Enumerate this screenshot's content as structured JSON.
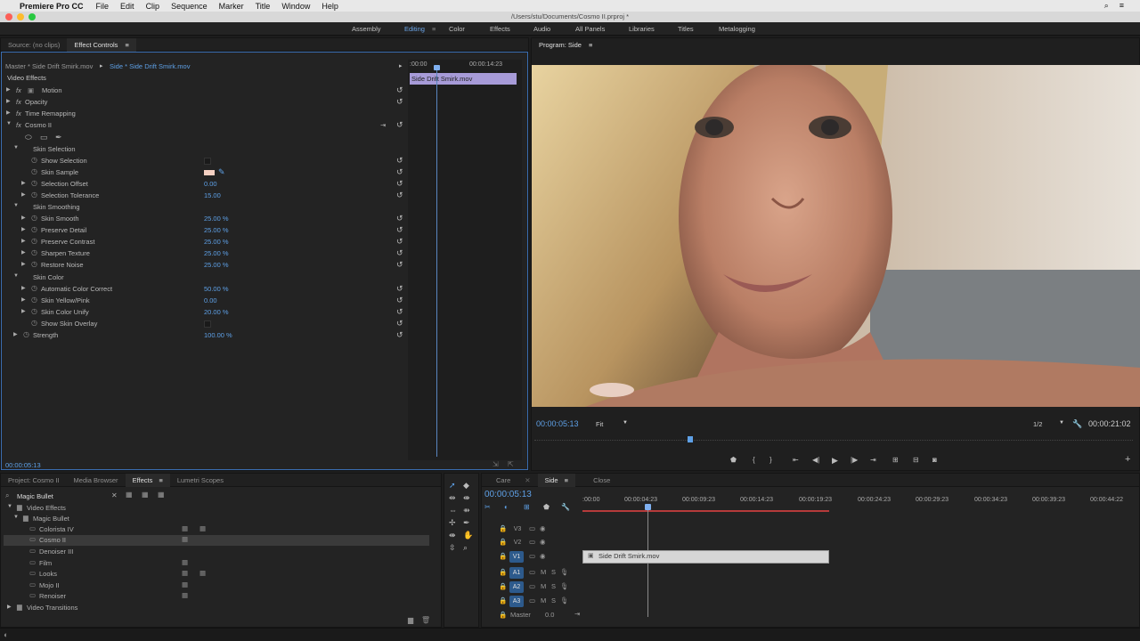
{
  "menubar": {
    "app": "Premiere Pro CC",
    "items": [
      "File",
      "Edit",
      "Clip",
      "Sequence",
      "Marker",
      "Title",
      "Window",
      "Help"
    ]
  },
  "titlebar": {
    "path": "/Users/stu/Documents/Cosmo II.prproj *"
  },
  "workspaces": [
    "Assembly",
    "Editing",
    "Color",
    "Effects",
    "Audio",
    "All Panels",
    "Libraries",
    "Titles",
    "Metalogging"
  ],
  "source_panel": {
    "tabs": [
      "Source: (no clips)",
      "Effect Controls"
    ],
    "master_label": "Master * Side Drift Smirk.mov",
    "clip_label": "Side * Side Drift Smirk.mov",
    "timecode_start": ":00:00",
    "timecode_end": "00:00:14:23",
    "clip_name": "Side Drift Smirk.mov",
    "video_effects_label": "Video Effects",
    "current_time": "00:00:05:13"
  },
  "effects": {
    "motion": "Motion",
    "opacity": "Opacity",
    "time_remapping": "Time Remapping",
    "cosmo": "Cosmo II",
    "skin_selection": "Skin Selection",
    "show_selection": "Show Selection",
    "skin_sample": "Skin Sample",
    "selection_offset": "Selection Offset",
    "selection_offset_val": "0.00",
    "selection_tolerance": "Selection Tolerance",
    "selection_tolerance_val": "15.00",
    "skin_smoothing": "Skin Smoothing",
    "skin_smooth": "Skin Smooth",
    "skin_smooth_val": "25.00 %",
    "preserve_detail": "Preserve Detail",
    "preserve_detail_val": "25.00 %",
    "preserve_contrast": "Preserve Contrast",
    "preserve_contrast_val": "25.00 %",
    "sharpen_texture": "Sharpen Texture",
    "sharpen_texture_val": "25.00 %",
    "restore_noise": "Restore Noise",
    "restore_noise_val": "25.00 %",
    "skin_color": "Skin Color",
    "auto_color": "Automatic Color Correct",
    "auto_color_val": "50.00 %",
    "skin_yellow": "Skin Yellow/Pink",
    "skin_yellow_val": "0.00",
    "skin_unify": "Skin Color Unify",
    "skin_unify_val": "20.00 %",
    "show_overlay": "Show Skin Overlay",
    "strength": "Strength",
    "strength_val": "100.00 %"
  },
  "program": {
    "title": "Program: Side",
    "timecode": "00:00:05:13",
    "fit": "Fit",
    "resolution": "1/2",
    "duration": "00:00:21:02"
  },
  "project_panel": {
    "tabs": [
      "Project: Cosmo II",
      "Media Browser",
      "Effects",
      "Lumetri Scopes"
    ],
    "search_value": "Magic Bullet",
    "tree": {
      "video_effects": "Video Effects",
      "magic_bullet": "Magic Bullet",
      "colorista": "Colorista IV",
      "cosmo": "Cosmo II",
      "denoiser": "Denoiser III",
      "film": "Film",
      "looks": "Looks",
      "mojo": "Mojo II",
      "renoiser": "Renoiser",
      "video_transitions": "Video Transitions"
    }
  },
  "timeline": {
    "tabs": [
      "Care",
      "Side",
      "Close"
    ],
    "timecode": "00:00:05:13",
    "ruler": [
      ":00:00",
      "00:00:04:23",
      "00:00:09:23",
      "00:00:14:23",
      "00:00:19:23",
      "00:00:24:23",
      "00:00:29:23",
      "00:00:34:23",
      "00:00:39:23",
      "00:00:44:22"
    ],
    "tracks": [
      "V3",
      "V2",
      "V1",
      "A1",
      "A2",
      "A3"
    ],
    "master": "Master",
    "master_val": "0.0",
    "clip": "Side Drift Smirk.mov"
  },
  "colors": {
    "accent": "#5ea0e6",
    "clip_fill": "#d6d6d6",
    "playhead": "#7fb0f0"
  }
}
